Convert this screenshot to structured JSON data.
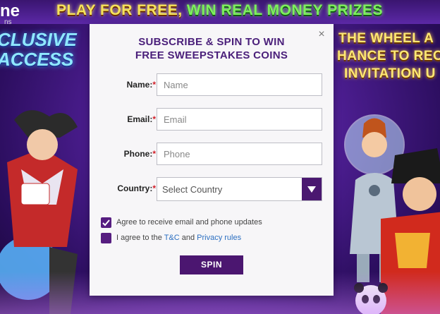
{
  "banner": {
    "part1": "PLAY FOR FREE,",
    "part2": "WIN REAL MONEY PRIZES"
  },
  "logo": {
    "fragment": "ne",
    "sub": "ns"
  },
  "promo_left": {
    "line1": "CLUSIVE",
    "line2": "ACCESS"
  },
  "promo_right": {
    "line1": "THE WHEEL A",
    "line2": "HANCE TO REC",
    "line3": "INVITATION U"
  },
  "modal": {
    "close_glyph": "×",
    "title_line1": "SUBSCRIBE & SPIN TO WIN",
    "title_line2": "FREE SWEEPSTAKES COINS",
    "fields": {
      "name": {
        "label": "Name:",
        "required": "*",
        "placeholder": "Name"
      },
      "email": {
        "label": "Email:",
        "required": "*",
        "placeholder": "Email"
      },
      "phone": {
        "label": "Phone:",
        "required": "*",
        "placeholder": "Phone"
      },
      "country": {
        "label": "Country:",
        "required": "*",
        "selected": "Select Country"
      }
    },
    "consent": {
      "updates": "Agree to receive email and phone updates",
      "terms_prefix": "I agree to the ",
      "terms_link": "T&C",
      "terms_middle": " and ",
      "privacy_link": "Privacy rules"
    },
    "spin_label": "SPIN"
  },
  "colors": {
    "accent": "#4b1670",
    "required": "#d0202a",
    "link": "#2c6fc1"
  }
}
